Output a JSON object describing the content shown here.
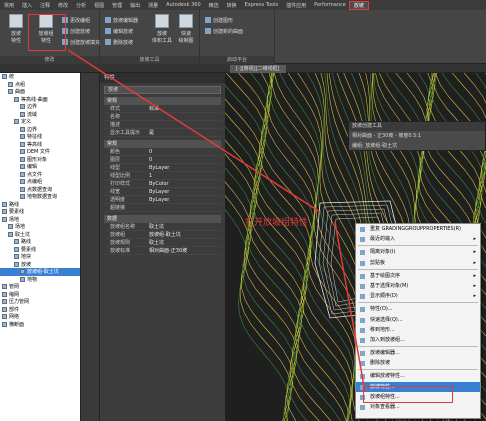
{
  "menubar": {
    "items": [
      "常用",
      "插入",
      "注释",
      "修改",
      "分析",
      "视图",
      "管理",
      "输出",
      "测量",
      "Autodesk 360",
      "精选",
      "转换",
      "Express Tools",
      "插件应用",
      "Performance",
      "放坡"
    ],
    "active_index": 15
  },
  "ribbon": {
    "group1": {
      "btn1": "放坡\n特性",
      "btn2": "放坡组\n特性",
      "small": [
        "更改编组",
        "创建放坡",
        "创建放坡填充"
      ],
      "title": "修改"
    },
    "group2": {
      "small": [
        "放坡编辑器",
        "编辑放坡",
        "删除放坡"
      ],
      "btn": "放坡\n体积工具",
      "btn2": "快速\n绘制图",
      "title": "放坡工具"
    },
    "group3": {
      "small": [
        "创建图形",
        "创建新的曲面"
      ],
      "title": "启动平台"
    }
  },
  "tabstrip": {
    "tab": "[-][俯视][二维线框]"
  },
  "tree": {
    "items": [
      {
        "label": "统",
        "indent": 0
      },
      {
        "label": "点组",
        "indent": 1
      },
      {
        "label": "曲面",
        "indent": 1
      },
      {
        "label": "等高线-曲面",
        "indent": 2
      },
      {
        "label": "边界",
        "indent": 3
      },
      {
        "label": "流域",
        "indent": 3
      },
      {
        "label": "定义",
        "indent": 2
      },
      {
        "label": "边界",
        "indent": 3
      },
      {
        "label": "特征线",
        "indent": 3
      },
      {
        "label": "等高线",
        "indent": 3
      },
      {
        "label": "DEM 文件",
        "indent": 3
      },
      {
        "label": "图形对象",
        "indent": 3
      },
      {
        "label": "编辑",
        "indent": 3
      },
      {
        "label": "点文件",
        "indent": 3
      },
      {
        "label": "点编组",
        "indent": 3
      },
      {
        "label": "点数据查询",
        "indent": 3
      },
      {
        "label": "地物数据查询",
        "indent": 3
      },
      {
        "label": "路线",
        "indent": 0
      },
      {
        "label": "要素线",
        "indent": 0
      },
      {
        "label": "场地",
        "indent": 0
      },
      {
        "label": "场地",
        "indent": 1
      },
      {
        "label": "取土坑",
        "indent": 1
      },
      {
        "label": "路线",
        "indent": 2
      },
      {
        "label": "要素线",
        "indent": 2
      },
      {
        "label": "地块",
        "indent": 2
      },
      {
        "label": "放坡",
        "indent": 2
      },
      {
        "label": "放坡组-取土坑",
        "indent": 3,
        "selected": true
      },
      {
        "label": "地物",
        "indent": 3
      },
      {
        "label": "管网",
        "indent": 0
      },
      {
        "label": "缩网",
        "indent": 0
      },
      {
        "label": "压力管网",
        "indent": 0
      },
      {
        "label": "部件",
        "indent": 0
      },
      {
        "label": "网络",
        "indent": 0
      },
      {
        "label": "横断面",
        "indent": 0
      }
    ]
  },
  "props": {
    "header": "特性",
    "selector": "放坡",
    "sections": [
      {
        "title": "常规",
        "rows": [
          [
            "样式",
            "标准"
          ],
          [
            "名称",
            ""
          ],
          [
            "描述",
            ""
          ],
          [
            "显示工具提示",
            "是"
          ]
        ]
      },
      {
        "title": "常规",
        "rows": [
          [
            "颜色",
            "0"
          ],
          [
            "图层",
            "0"
          ],
          [
            "线型",
            "ByLayer"
          ],
          [
            "线型比例",
            "1"
          ],
          [
            "打印样式",
            "ByColor"
          ],
          [
            "线宽",
            "ByLayer"
          ],
          [
            "透明度",
            "ByLayer"
          ],
          [
            "超链接",
            ""
          ]
        ]
      },
      {
        "title": "数据",
        "rows": [
          [
            "放坡组名称",
            "取土坑"
          ],
          [
            "放坡组",
            "放坡组-取土坑"
          ],
          [
            "放坡规则",
            "取土坑"
          ],
          [
            "放坡标准",
            "相对曲面-正30坡"
          ]
        ]
      }
    ]
  },
  "gradingtool": {
    "title": "放坡创建工具",
    "row1": "相对曲面 - 正30坡 - 坡度0.5:1",
    "row2": "编组: 放坡组-取土坑"
  },
  "contextmenu": {
    "items": [
      {
        "label": "重复 GRADINGGROUPPROPERTIES(R)",
        "arrow": false
      },
      {
        "label": "最近的输入",
        "arrow": true
      },
      {
        "sep": true
      },
      {
        "label": "隔离对象(I)",
        "arrow": true
      },
      {
        "label": "剪贴板",
        "arrow": true
      },
      {
        "sep": true
      },
      {
        "label": "基于绘图次序",
        "arrow": true
      },
      {
        "label": "基于选择对象(M)",
        "arrow": true
      },
      {
        "label": "显示顺序(D)",
        "arrow": true
      },
      {
        "sep": true
      },
      {
        "label": "特性(O)...",
        "arrow": false
      },
      {
        "label": "快速选择(Q)...",
        "arrow": false
      },
      {
        "label": "移到地形...",
        "arrow": false
      },
      {
        "label": "加入到放坡组...",
        "arrow": false
      },
      {
        "sep": true
      },
      {
        "label": "放坡编辑器...",
        "arrow": false
      },
      {
        "label": "删除放坡",
        "arrow": false
      },
      {
        "sep": true
      },
      {
        "label": "编辑放坡特性...",
        "arrow": false
      },
      {
        "label": "放坡特性...",
        "arrow": false,
        "selected": true
      },
      {
        "label": "放坡组特性...",
        "arrow": false
      },
      {
        "label": "对象查看器...",
        "arrow": false
      }
    ]
  },
  "annotation": "打开放坡组特性",
  "colors": {
    "accent_red": "#e23a3a",
    "selection_blue": "#3a80d2",
    "contour_yellow": "#c9c23a",
    "contour_green": "#3a8a3a"
  }
}
